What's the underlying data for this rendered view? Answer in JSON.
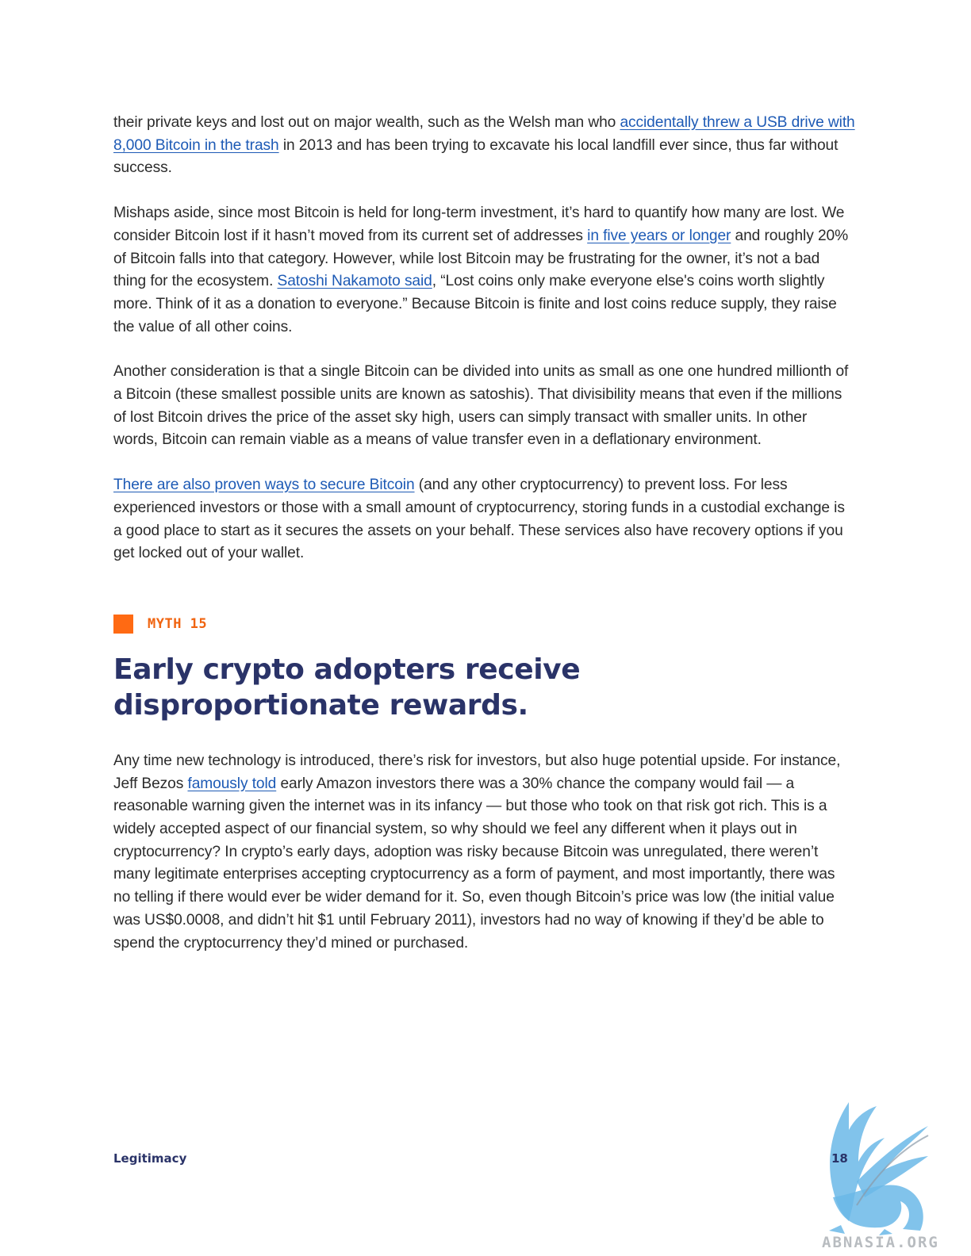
{
  "paragraphs": {
    "p1": {
      "t1": "their private keys and lost out on major wealth, such as the Welsh man who ",
      "link1": "accidentally threw a USB drive with 8,000 Bitcoin in the trash",
      "t2": " in 2013 and has been trying to excavate his local landfill ever since, thus far without success."
    },
    "p2": {
      "t1": "Mishaps aside, since most Bitcoin is held for long-term investment, it’s hard to quantify how many are lost. We consider Bitcoin lost if it hasn’t moved from its current set of addresses ",
      "link1": "in five years or longer",
      "t2": " and roughly 20% of Bitcoin falls into that category. However, while lost Bitcoin may be frustrating for the owner, it’s not a bad thing for the ecosystem. ",
      "link2": "Satoshi Nakamoto said",
      "t3": ", “Lost coins only make everyone else's coins worth slightly more. Think of it as a donation to everyone.” Because Bitcoin is finite and lost coins reduce supply, they raise the value of all other coins."
    },
    "p3": {
      "t1": "Another consideration is that a single Bitcoin can be divided into units as small as one one hundred millionth of a Bitcoin (these smallest possible units are known as satoshis). That divisibility means that even if the millions of lost Bitcoin drives the price of the asset sky high, users can simply transact with smaller units. In other words, Bitcoin can remain viable as a means of value transfer even in a deflationary environment."
    },
    "p4": {
      "link1": "There are also proven ways to secure Bitcoin",
      "t1": " (and any other cryptocurrency) to prevent loss. For less experienced investors or those with a small amount of cryptocurrency, storing funds in a custodial exchange is a good place to start as it secures the assets on your behalf. These services also have recovery options if you get locked out of your wallet."
    }
  },
  "myth": {
    "label": "MYTH 15",
    "heading": "Early crypto adopters receive disproportionate rewards.",
    "accent_color": "#ff6a13"
  },
  "p5": {
    "t1": "Any time new technology is introduced, there’s risk for investors, but also huge potential upside. For instance, Jeff Bezos ",
    "link1": "famously told",
    "t2": " early Amazon investors there was a 30% chance the company would fail — a reasonable warning given the internet was in its infancy — but those who took on that risk got rich. This is a widely accepted aspect of our financial system, so why should we feel any different when it plays out in cryptocurrency? In crypto’s early days, adoption was risky because Bitcoin was unregulated, there weren’t many legitimate enterprises accepting cryptocurrency as a form of payment, and most importantly, there was no telling if there would ever be wider demand for it. So, even though Bitcoin’s price was low (the initial value was US$0.0008, and didn’t hit $1 until February 2011), investors had no way of knowing if they’d be able to spend the cryptocurrency they’d mined or purchased."
  },
  "footer": {
    "section": "Legitimacy",
    "page_number": "18"
  },
  "watermark": {
    "text": "ABNASIA.ORG",
    "icon": "griffin-logo-icon"
  },
  "colors": {
    "link": "#1d5ab5",
    "heading": "#2a3368",
    "body_text": "#2b2b2b"
  }
}
